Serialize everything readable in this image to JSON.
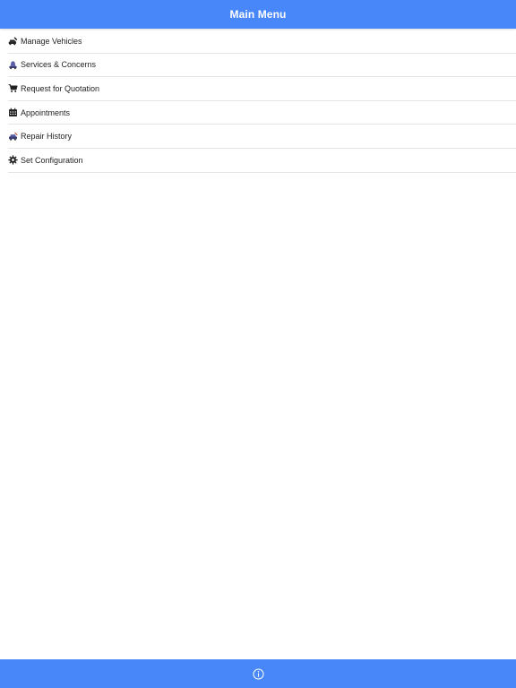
{
  "header": {
    "title": "Main Menu"
  },
  "theme": {
    "bar_color": "#4887fa",
    "text_color": "#1f1f1f",
    "divider_color": "#e4e4e4"
  },
  "menu": {
    "items": [
      {
        "label": "Manage Vehicles",
        "icon": "car-wrench-icon"
      },
      {
        "label": "Services & Concerns",
        "icon": "bell-car-icon"
      },
      {
        "label": "Request for Quotation",
        "icon": "cart-icon"
      },
      {
        "label": "Appointments",
        "icon": "calendar-icon"
      },
      {
        "label": "Repair History",
        "icon": "car-history-icon"
      },
      {
        "label": "Set Configuration",
        "icon": "gear-icon"
      }
    ]
  },
  "footer": {
    "info_icon": "info-icon"
  }
}
